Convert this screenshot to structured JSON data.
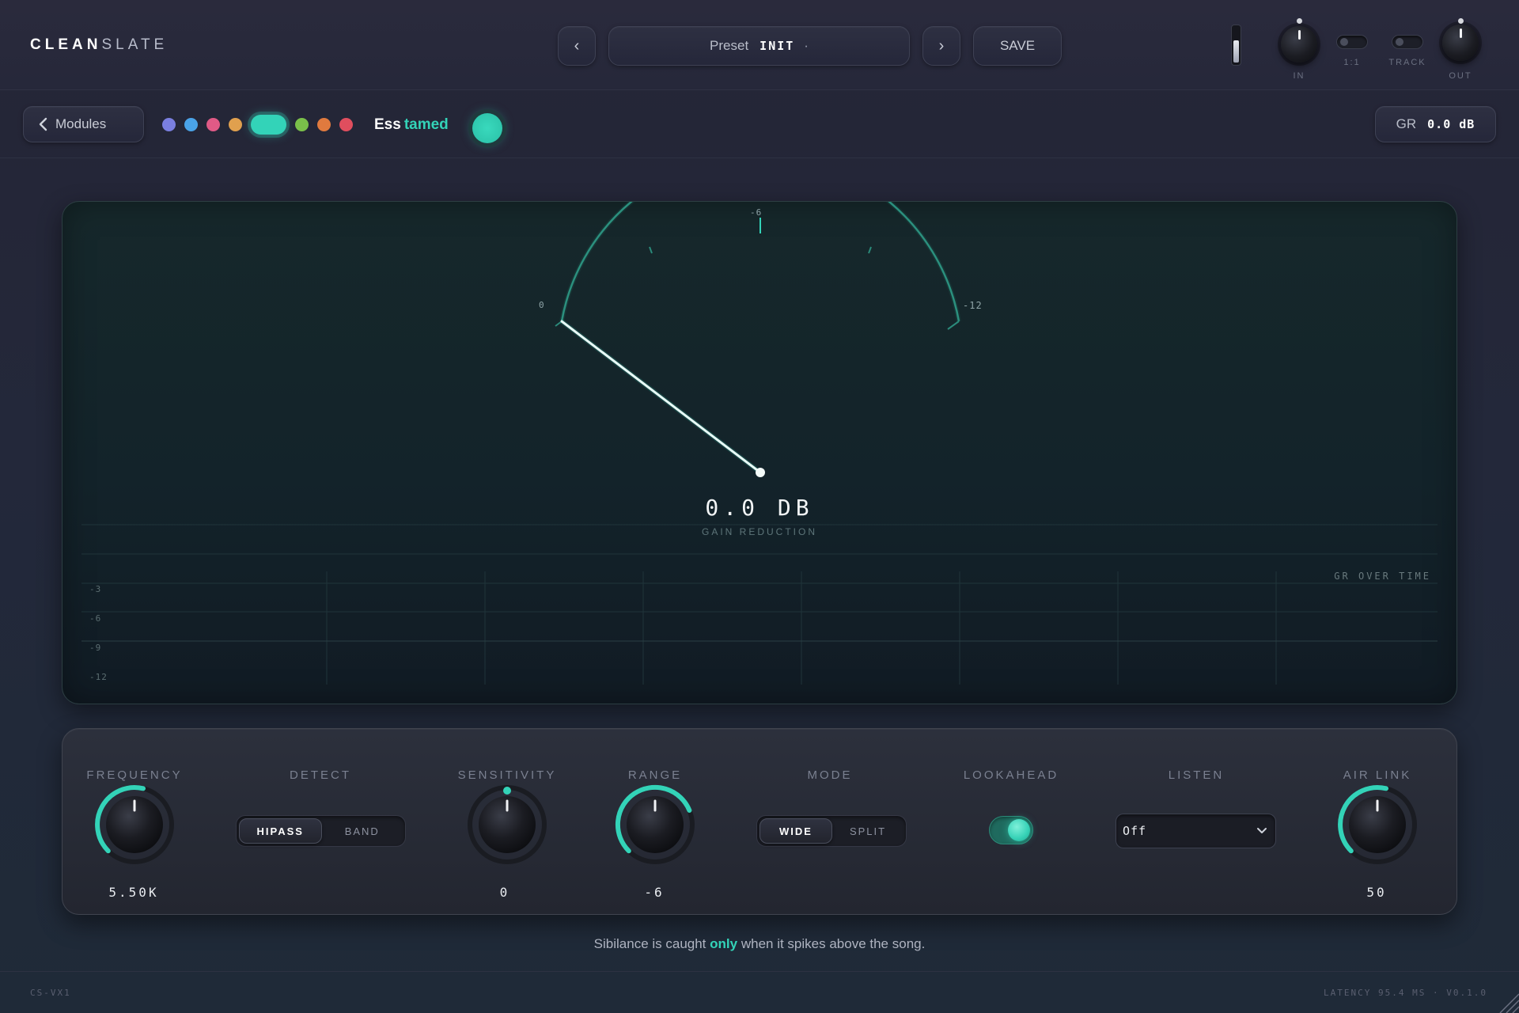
{
  "header": {
    "logo_bold": "CLEAN",
    "logo_light": "SLATE",
    "prev_label": "‹",
    "next_label": "›",
    "preset_label": "Preset",
    "preset_name": "INIT",
    "preset_modified": "·",
    "save_label": "SAVE",
    "in_label": "IN",
    "ratio_label": "1:1",
    "track_label": "TRACK",
    "out_label": "OUT"
  },
  "module_bar": {
    "modules_label": "Modules",
    "swatches": [
      "#7a7fe0",
      "#4aa3e8",
      "#e05a86",
      "#e0a04e",
      "#33d3b8",
      "#7ac04a",
      "#e07a3e",
      "#e04e5e"
    ],
    "active_swatch": 4,
    "module_title": "Ess",
    "module_title_accent": "tamed",
    "gr_label": "GR",
    "gr_value": "0.0 dB"
  },
  "meter": {
    "scale_0": "0",
    "scale_mid": "-6",
    "scale_max": "-12",
    "readout": "0.0 DB",
    "readout_label": "GAIN REDUCTION",
    "value_db": 0,
    "graph_label": "GR OVER TIME",
    "graph_ticks": [
      "-3",
      "-6",
      "-9",
      "-12"
    ]
  },
  "controls": {
    "frequency": {
      "label": "FREQUENCY",
      "value": "5.50K",
      "level": 0.55
    },
    "detect": {
      "label": "DETECT",
      "options": [
        "HIPASS",
        "BAND"
      ],
      "selected": "HIPASS"
    },
    "sensitivity": {
      "label": "SENSITIVITY",
      "value": "0",
      "level": 0.5
    },
    "range": {
      "label": "RANGE",
      "value": "-6",
      "level": 0.75
    },
    "mode": {
      "label": "MODE",
      "options": [
        "WIDE",
        "SPLIT"
      ],
      "selected": "WIDE"
    },
    "lookahead": {
      "label": "LOOKAHEAD",
      "on": true
    },
    "listen": {
      "label": "LISTEN",
      "value": "Off"
    },
    "air_link": {
      "label": "AIR LINK",
      "value": "50",
      "level": 0.55
    }
  },
  "caption": {
    "before": "Sibilance is caught",
    "accent": "only",
    "after": "when it spikes above the song."
  },
  "footer": {
    "left": "CS-VX1",
    "right": "LATENCY 95.4 MS · V0.1.0"
  },
  "colors": {
    "accent": "#33d3b8",
    "background": "#23283a"
  }
}
